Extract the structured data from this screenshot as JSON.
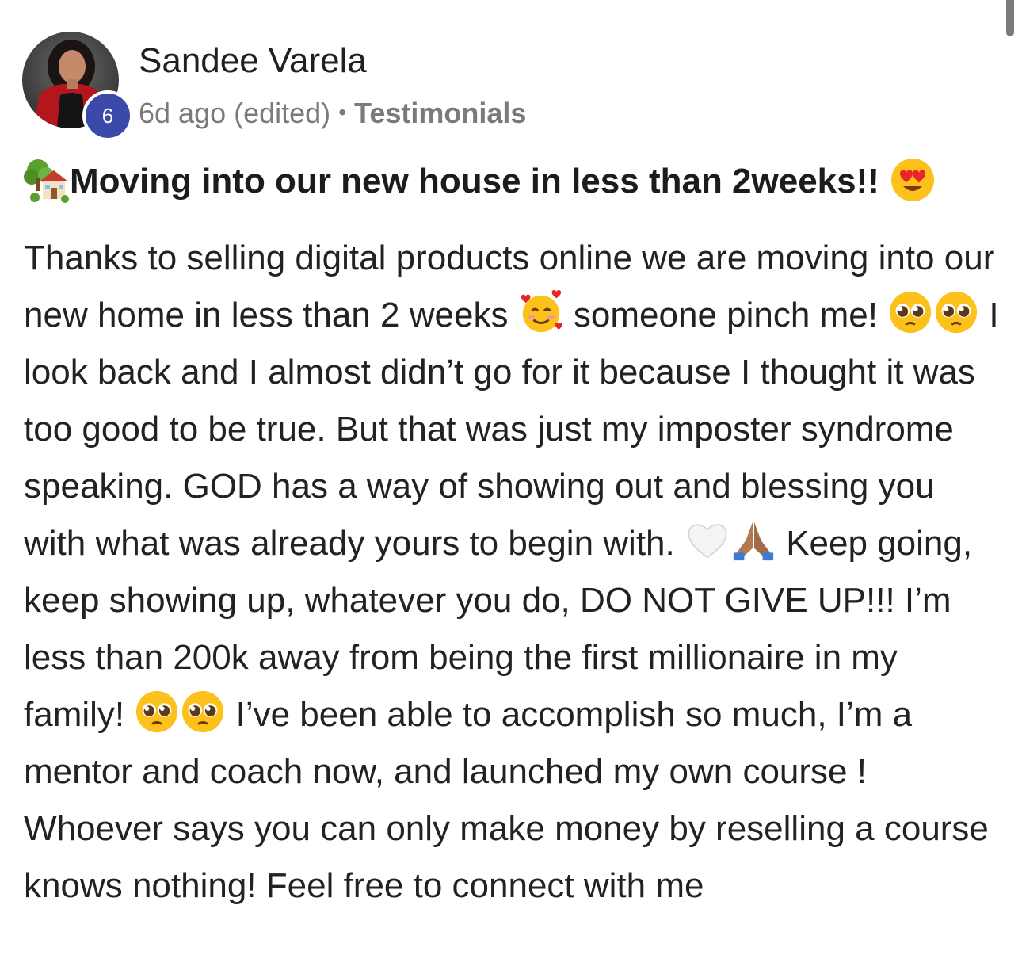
{
  "author": {
    "name": "Sandee Varela",
    "level": "6"
  },
  "meta": {
    "time": "6d ago (edited)",
    "separator": "•",
    "category": "Testimonials"
  },
  "post": {
    "title_text": "Moving into our new house in less than 2weeks!!",
    "body_1": "Thanks to selling digital products online we are moving into our new home in less than 2 weeks",
    "body_2": "someone pinch me!",
    "body_3": "I look back and I almost didn’t go for it because I thought it was too good to be true. But that was just my imposter syndrome speaking. GOD has a way of showing out and blessing you with what was already yours to begin with.",
    "body_4": "Keep going, keep showing up, whatever you do, DO NOT GIVE UP!!! I’m less than 200k away from being the first millionaire in my family!",
    "body_5": "I’ve been able to accomplish so much, I’m a mentor and coach now, and launched my own course ! Whoever says you can only make money by reselling a course knows nothing! Feel free to connect with me"
  },
  "icons": {
    "title_leading": "house-with-garden-icon",
    "title_trailing": "heart-eyes-emoji-icon",
    "smiling_hearts": "smiling-face-with-hearts-emoji-icon",
    "pleading": "pleading-face-emoji-icon",
    "white_heart": "white-heart-emoji-icon",
    "folded_hands": "folded-hands-emoji-icon"
  },
  "colors": {
    "badge": "#3b4aa8",
    "meta_text": "#7a7a7a",
    "body_text": "#222222"
  }
}
